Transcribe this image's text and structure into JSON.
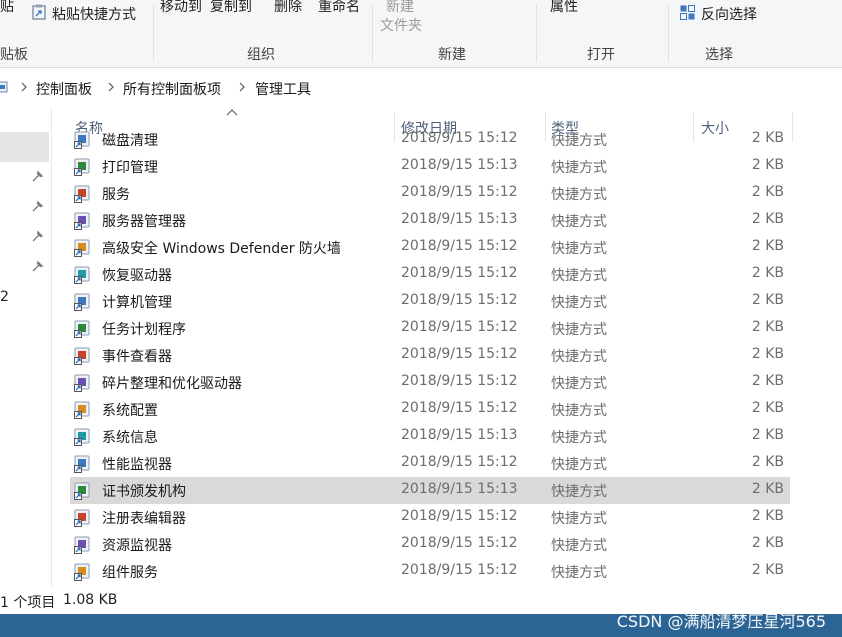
{
  "ribbon": {
    "paste_fragment": "贴",
    "paste_shortcut": "粘贴快捷方式",
    "move_to": "移动到",
    "copy_to": "复制到",
    "delete": "删除",
    "rename": "重命名",
    "new_fragment": "新建",
    "new_folder_line2": "文件夹",
    "properties": "属性",
    "invert_selection": "反向选择",
    "groups": {
      "clipboard": "贴板",
      "organize": "组织",
      "new": "新建",
      "open": "打开",
      "select": "选择"
    }
  },
  "address": {
    "crumbs": [
      "控制面板",
      "所有控制面板项",
      "管理工具"
    ]
  },
  "nav": {
    "partial_label": "2"
  },
  "columns": {
    "name": "名称",
    "modified": "修改日期",
    "type": "类型",
    "size": "大小"
  },
  "files": [
    {
      "name": "磁盘清理",
      "date": "2018/9/15 15:12",
      "type": "快捷方式",
      "size": "2 KB"
    },
    {
      "name": "打印管理",
      "date": "2018/9/15 15:13",
      "type": "快捷方式",
      "size": "2 KB"
    },
    {
      "name": "服务",
      "date": "2018/9/15 15:12",
      "type": "快捷方式",
      "size": "2 KB"
    },
    {
      "name": "服务器管理器",
      "date": "2018/9/15 15:13",
      "type": "快捷方式",
      "size": "2 KB"
    },
    {
      "name": "高级安全 Windows Defender 防火墙",
      "date": "2018/9/15 15:12",
      "type": "快捷方式",
      "size": "2 KB"
    },
    {
      "name": "恢复驱动器",
      "date": "2018/9/15 15:12",
      "type": "快捷方式",
      "size": "2 KB"
    },
    {
      "name": "计算机管理",
      "date": "2018/9/15 15:12",
      "type": "快捷方式",
      "size": "2 KB"
    },
    {
      "name": "任务计划程序",
      "date": "2018/9/15 15:12",
      "type": "快捷方式",
      "size": "2 KB"
    },
    {
      "name": "事件查看器",
      "date": "2018/9/15 15:12",
      "type": "快捷方式",
      "size": "2 KB"
    },
    {
      "name": "碎片整理和优化驱动器",
      "date": "2018/9/15 15:12",
      "type": "快捷方式",
      "size": "2 KB"
    },
    {
      "name": "系统配置",
      "date": "2018/9/15 15:12",
      "type": "快捷方式",
      "size": "2 KB"
    },
    {
      "name": "系统信息",
      "date": "2018/9/15 15:13",
      "type": "快捷方式",
      "size": "2 KB"
    },
    {
      "name": "性能监视器",
      "date": "2018/9/15 15:12",
      "type": "快捷方式",
      "size": "2 KB"
    },
    {
      "name": "证书颁发机构",
      "date": "2018/9/15 15:13",
      "type": "快捷方式",
      "size": "2 KB",
      "selected": true
    },
    {
      "name": "注册表编辑器",
      "date": "2018/9/15 15:12",
      "type": "快捷方式",
      "size": "2 KB"
    },
    {
      "name": "资源监视器",
      "date": "2018/9/15 15:12",
      "type": "快捷方式",
      "size": "2 KB"
    },
    {
      "name": "组件服务",
      "date": "2018/9/15 15:12",
      "type": "快捷方式",
      "size": "2 KB"
    }
  ],
  "status": {
    "items": "1 个项目",
    "size": "1.08 KB"
  },
  "watermark": "CSDN @满船清梦压星河565",
  "colors": {
    "selected_row": "#d9d9d9",
    "annotation_arrow": "#e8262a",
    "header_text": "#4c607a",
    "taskbar": "#2d6496"
  }
}
